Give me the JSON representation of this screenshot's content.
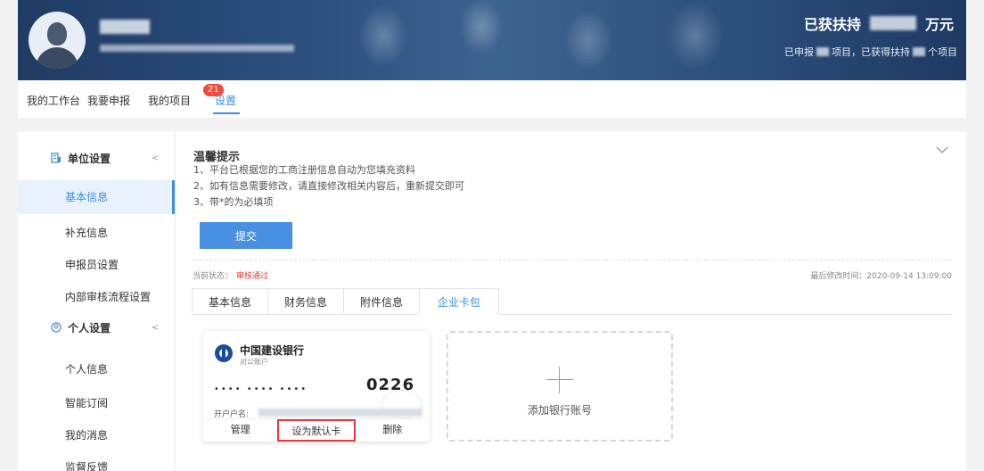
{
  "header": {
    "support_label": "已获扶持",
    "support_unit": "万元",
    "stats": {
      "prefix": "已申报",
      "mid": "项目，已获得扶持",
      "suffix": "个项目"
    }
  },
  "nav": {
    "tabs": [
      "我的工作台",
      "我要申报",
      "我的项目",
      "设置"
    ],
    "active": "设置",
    "badge": "21"
  },
  "sidebar": {
    "groups": [
      {
        "label": "单位设置",
        "icon": "building-icon",
        "items": [
          "基本信息",
          "补充信息",
          "申报员设置",
          "内部审核流程设置"
        ]
      },
      {
        "label": "个人设置",
        "icon": "user-circle-icon",
        "items": [
          "个人信息",
          "智能订阅",
          "我的消息",
          "监督反馈"
        ]
      }
    ],
    "active_item": "基本信息"
  },
  "tip": {
    "title": "温馨提示",
    "lines": [
      "1、平台已根据您的工商注册信息自动为您填充资料",
      "2、如有信息需要修改，请直接修改相关内容后，重新提交即可",
      "3、带*的为必填项"
    ]
  },
  "submit_label": "提交",
  "status": {
    "label": "当前状态：",
    "value": "审核通过"
  },
  "modified": "最后修改时间：2020-09-14 13:09:00",
  "subtabs": [
    "基本信息",
    "财务信息",
    "附件信息",
    "企业卡包"
  ],
  "active_subtab": "企业卡包",
  "card": {
    "bank": "中国建设银行",
    "type": "对公账户",
    "masked": "•••• •••• ••••",
    "last4": "0226",
    "holder_label": "开户户名:",
    "actions": [
      "管理",
      "设为默认卡",
      "删除"
    ]
  },
  "add_card_label": "添加银行账号",
  "colors": {
    "accent": "#3a8ee6",
    "danger": "#e4393c",
    "badge": "#f04b3b"
  }
}
